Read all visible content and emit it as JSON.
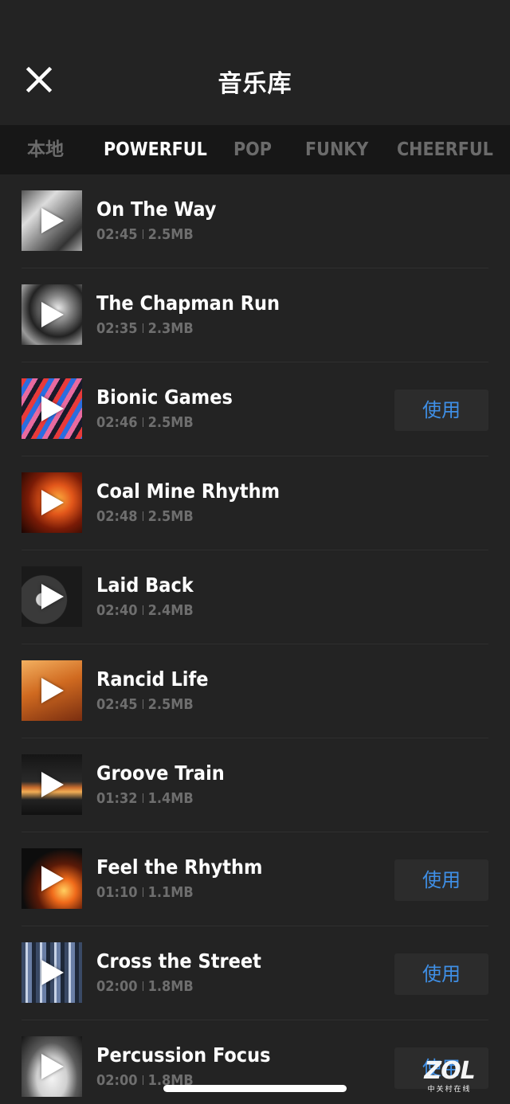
{
  "header": {
    "title": "音乐库",
    "close_icon": "close-icon"
  },
  "tabs": [
    {
      "label": "本地",
      "active": false
    },
    {
      "label": "POWERFUL",
      "active": true
    },
    {
      "label": "POP",
      "active": false
    },
    {
      "label": "FUNKY",
      "active": false
    },
    {
      "label": "CHEERFUL",
      "active": false
    }
  ],
  "tracks": [
    {
      "title": "On The Way",
      "duration": "02:45",
      "size": "2.5MB",
      "use_label": ""
    },
    {
      "title": "The Chapman Run",
      "duration": "02:35",
      "size": "2.3MB",
      "use_label": ""
    },
    {
      "title": "Bionic Games",
      "duration": "02:46",
      "size": "2.5MB",
      "use_label": "使用"
    },
    {
      "title": "Coal Mine Rhythm",
      "duration": "02:48",
      "size": "2.5MB",
      "use_label": ""
    },
    {
      "title": "Laid Back",
      "duration": "02:40",
      "size": "2.4MB",
      "use_label": ""
    },
    {
      "title": "Rancid Life",
      "duration": "02:45",
      "size": "2.5MB",
      "use_label": ""
    },
    {
      "title": "Groove Train",
      "duration": "01:32",
      "size": "1.4MB",
      "use_label": ""
    },
    {
      "title": "Feel the Rhythm",
      "duration": "01:10",
      "size": "1.1MB",
      "use_label": "使用"
    },
    {
      "title": "Cross the Street",
      "duration": "02:00",
      "size": "1.8MB",
      "use_label": "使用"
    },
    {
      "title": "Percussion Focus",
      "duration": "02:00",
      "size": "1.8MB",
      "use_label": "使用"
    }
  ],
  "watermark": {
    "logo": "ZOL",
    "sub": "中关村在线"
  },
  "colors": {
    "background": "#232323",
    "tab_bar": "#171717",
    "accent": "#3f8fe6",
    "muted_text": "#6e6e6e"
  }
}
